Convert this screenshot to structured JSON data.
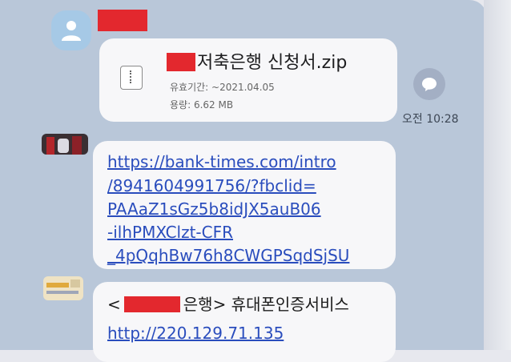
{
  "message1": {
    "file_name": "저축은행 신청서.zip",
    "expiry": "유효기간: ~2021.04.05",
    "size": "용량: 6.62 MB",
    "time": "오전 10:28"
  },
  "message2": {
    "link_lines": [
      "https://bank-times.com/intro",
      "/8941604991756/?fbclid=",
      "PAAaZ1sGz5b8idJX5auB06",
      "-ilhPMXClzt-CFR",
      "_4pQqhBw76h8CWGPSqdSjSU"
    ]
  },
  "message3": {
    "open_bracket": "<",
    "title_rest": "은행> 휴대폰인증서비스",
    "link": "http://220.129.71.135"
  },
  "icons": [
    "avatar-person-icon",
    "zip-file-icon",
    "share-icon"
  ],
  "colors": {
    "background": "#b9c7d9",
    "bubble": "#f7f7f9",
    "link": "#2a4dbd",
    "redaction": "#e3282e"
  }
}
